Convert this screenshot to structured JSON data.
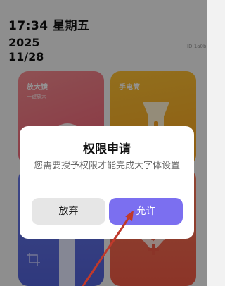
{
  "status": {
    "time": "17:34 星期五",
    "year": "2025",
    "date": "11/28",
    "side_id": "ID:1a0b"
  },
  "tiles": [
    {
      "title": "放大镜",
      "subtitle": "一键放大"
    },
    {
      "title": "手电筒"
    }
  ],
  "dialog": {
    "title": "权限申请",
    "message": "您需要授予权限才能完成大字体设置",
    "cancel_label": "放弃",
    "allow_label": "允许"
  },
  "colors": {
    "accent": "#7b6ff0",
    "tile_magnifier": "#ee5d73",
    "tile_flashlight": "#f6a11f",
    "tile_bottom_left": "#5262d8",
    "tile_bottom_right": "#f05a45",
    "annotation_arrow": "#c0392b"
  },
  "icons": [
    "magnifier-icon",
    "flashlight-icon",
    "cross-plus-icon",
    "annotation-arrow-icon"
  ]
}
